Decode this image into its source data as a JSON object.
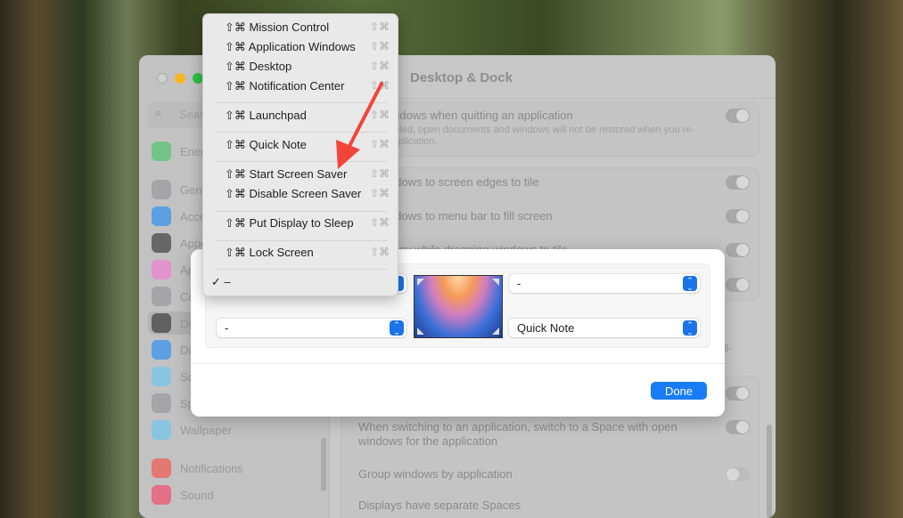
{
  "window": {
    "title": "Desktop & Dock",
    "search_placeholder": "Search"
  },
  "sidebar": {
    "items": [
      {
        "label": "Energy",
        "color": "#34c759"
      },
      {
        "label": "General",
        "color": "#8e8e93"
      },
      {
        "label": "Accessibility",
        "color": "#0a84ff"
      },
      {
        "label": "Appearance",
        "color": "#1c1c1e"
      },
      {
        "label": "Apple Intelligence & Siri",
        "color": "#ff6bd5"
      },
      {
        "label": "Control Center",
        "color": "#8e8e93"
      },
      {
        "label": "Desktop & Dock",
        "color": "#1c1c1e"
      },
      {
        "label": "Displays",
        "color": "#0a84ff"
      },
      {
        "label": "Screen Saver",
        "color": "#5ac8fa"
      },
      {
        "label": "Spotlight",
        "color": "#8e8e93"
      },
      {
        "label": "Wallpaper",
        "color": "#5ac8fa"
      },
      {
        "label": "Notifications",
        "color": "#ff3b30"
      },
      {
        "label": "Sound",
        "color": "#ff2d55"
      }
    ]
  },
  "settings": {
    "close_windows": "Close windows when quitting an application",
    "close_windows_sub": "When enabled, open documents and windows will not be restored when you re-open an application.",
    "drag_edges": "Drag windows to screen edges to tile",
    "drag_menubar": "Drag windows to menu bar to fill screen",
    "hold_key": "Hold ⌥ key while dragging windows to tile",
    "switch_space": "When switching to an application, switch to a Space with open windows for the application",
    "group_windows": "Group windows by application",
    "separate_spaces": "Displays have separate Spaces",
    "partial_text": "ll-"
  },
  "hot_corners": {
    "top_left": "–",
    "top_right": "-",
    "bottom_left": "-",
    "bottom_right": "Quick Note",
    "done_label": "Done"
  },
  "menu": {
    "shortcut": "⇧⌘",
    "items": [
      "⇧⌘ Mission Control",
      "⇧⌘ Application Windows",
      "⇧⌘ Desktop",
      "⇧⌘ Notification Center",
      "⇧⌘ Launchpad",
      "⇧⌘ Quick Note",
      "⇧⌘ Start Screen Saver",
      "⇧⌘ Disable Screen Saver",
      "⇧⌘ Put Display to Sleep",
      "⇧⌘ Lock Screen"
    ],
    "checked_item": "–",
    "check_mark": "✓"
  },
  "colors": {
    "accent": "#1a7cf5",
    "annotation_arrow": "#f2453a"
  }
}
